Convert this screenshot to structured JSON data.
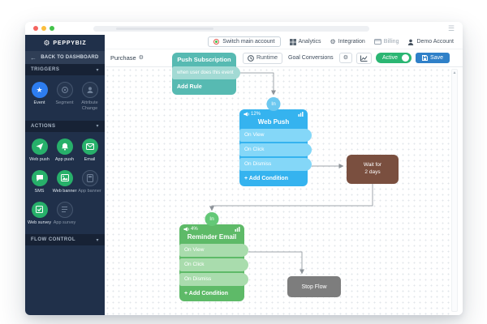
{
  "top_nav": {
    "switch_account_label": "Switch main account",
    "analytics_label": "Analytics",
    "integration_label": "Integration",
    "billing_label": "Billing",
    "account_label": "Demo Account"
  },
  "sidebar": {
    "logo_text": "PEPPYBIZ",
    "back_label": "BACK TO DASHBOARD",
    "triggers": {
      "title": "TRIGGERS",
      "items": [
        {
          "label": "Event",
          "state": "enabled"
        },
        {
          "label": "Segment",
          "state": "disabled"
        },
        {
          "label": "Attribute Change",
          "state": "disabled"
        }
      ]
    },
    "actions": {
      "title": "ACTIONS",
      "items": [
        {
          "label": "Web push",
          "state": "enabled"
        },
        {
          "label": "App push",
          "state": "enabled"
        },
        {
          "label": "Email",
          "state": "enabled"
        },
        {
          "label": "SMS",
          "state": "enabled"
        },
        {
          "label": "Web banner",
          "state": "enabled"
        },
        {
          "label": "App banner",
          "state": "disabled"
        },
        {
          "label": "Web survey",
          "state": "enabled"
        },
        {
          "label": "App survey",
          "state": "disabled"
        }
      ]
    },
    "flow_control": {
      "title": "FLOW CONTROL"
    }
  },
  "toolbar": {
    "flow_name": "Purchase",
    "runtime_label": "Runtime",
    "goal_conversions_label": "Goal Conversions",
    "active_label": "Active",
    "save_label": "Save"
  },
  "flow": {
    "push_subscription": {
      "title": "Push Subscription",
      "rule": "when user does this event",
      "footer": "Add Rule"
    },
    "web_push": {
      "badge": "In",
      "stat": "12%",
      "title": "Web Push",
      "rows": [
        "On View",
        "On Click",
        "On Dismiss"
      ],
      "footer": "+ Add Condition"
    },
    "wait": {
      "line1": "Wait for",
      "line2": "2 days"
    },
    "reminder_email": {
      "badge": "In",
      "stat": "4%",
      "title": "Reminder Email",
      "rows": [
        "On View",
        "On Click",
        "On Dismiss"
      ],
      "footer": "+ Add Condition"
    },
    "stop": {
      "label": "Stop Flow"
    }
  },
  "colors": {
    "sidebar_bg": "#20304a",
    "trigger_blue": "#2d7df0",
    "action_green": "#27b06a",
    "accent_green": "#2bb673",
    "save_blue": "#2f80c8",
    "node_teal": "#57bab2",
    "node_teal_light": "#a2dad4",
    "node_blue": "#35b3ef",
    "node_blue_light": "#84d7f8",
    "node_green": "#5eba68",
    "node_green_light": "#a9dcad",
    "node_brown": "#7a4f3f",
    "node_gray": "#7d7d7d"
  }
}
